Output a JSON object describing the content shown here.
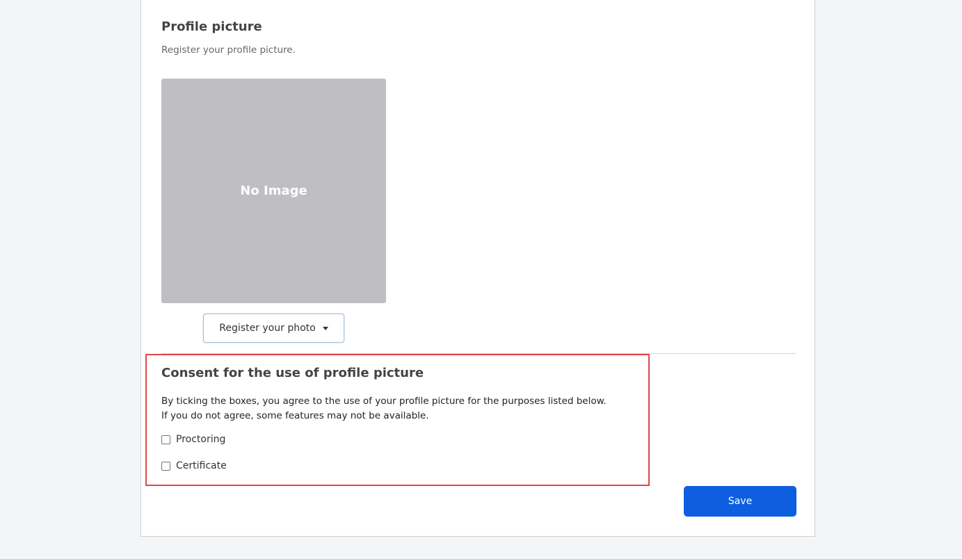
{
  "profile": {
    "title": "Profile picture",
    "description": "Register your profile picture.",
    "placeholder_text": "No Image",
    "register_button_label": "Register your photo",
    "register_button_icon": "caret-down-icon"
  },
  "consent": {
    "title": "Consent for the use of profile picture",
    "description_line1": "By ticking the boxes, you agree to the use of your profile picture for the purposes listed below.",
    "description_line2": "If you do not agree, some features may not be available.",
    "options": [
      {
        "label": "Proctoring",
        "checked": false
      },
      {
        "label": "Certificate",
        "checked": false
      }
    ],
    "highlight_color": "#e04646"
  },
  "actions": {
    "save_label": "Save",
    "save_color": "#0d5fe0"
  }
}
